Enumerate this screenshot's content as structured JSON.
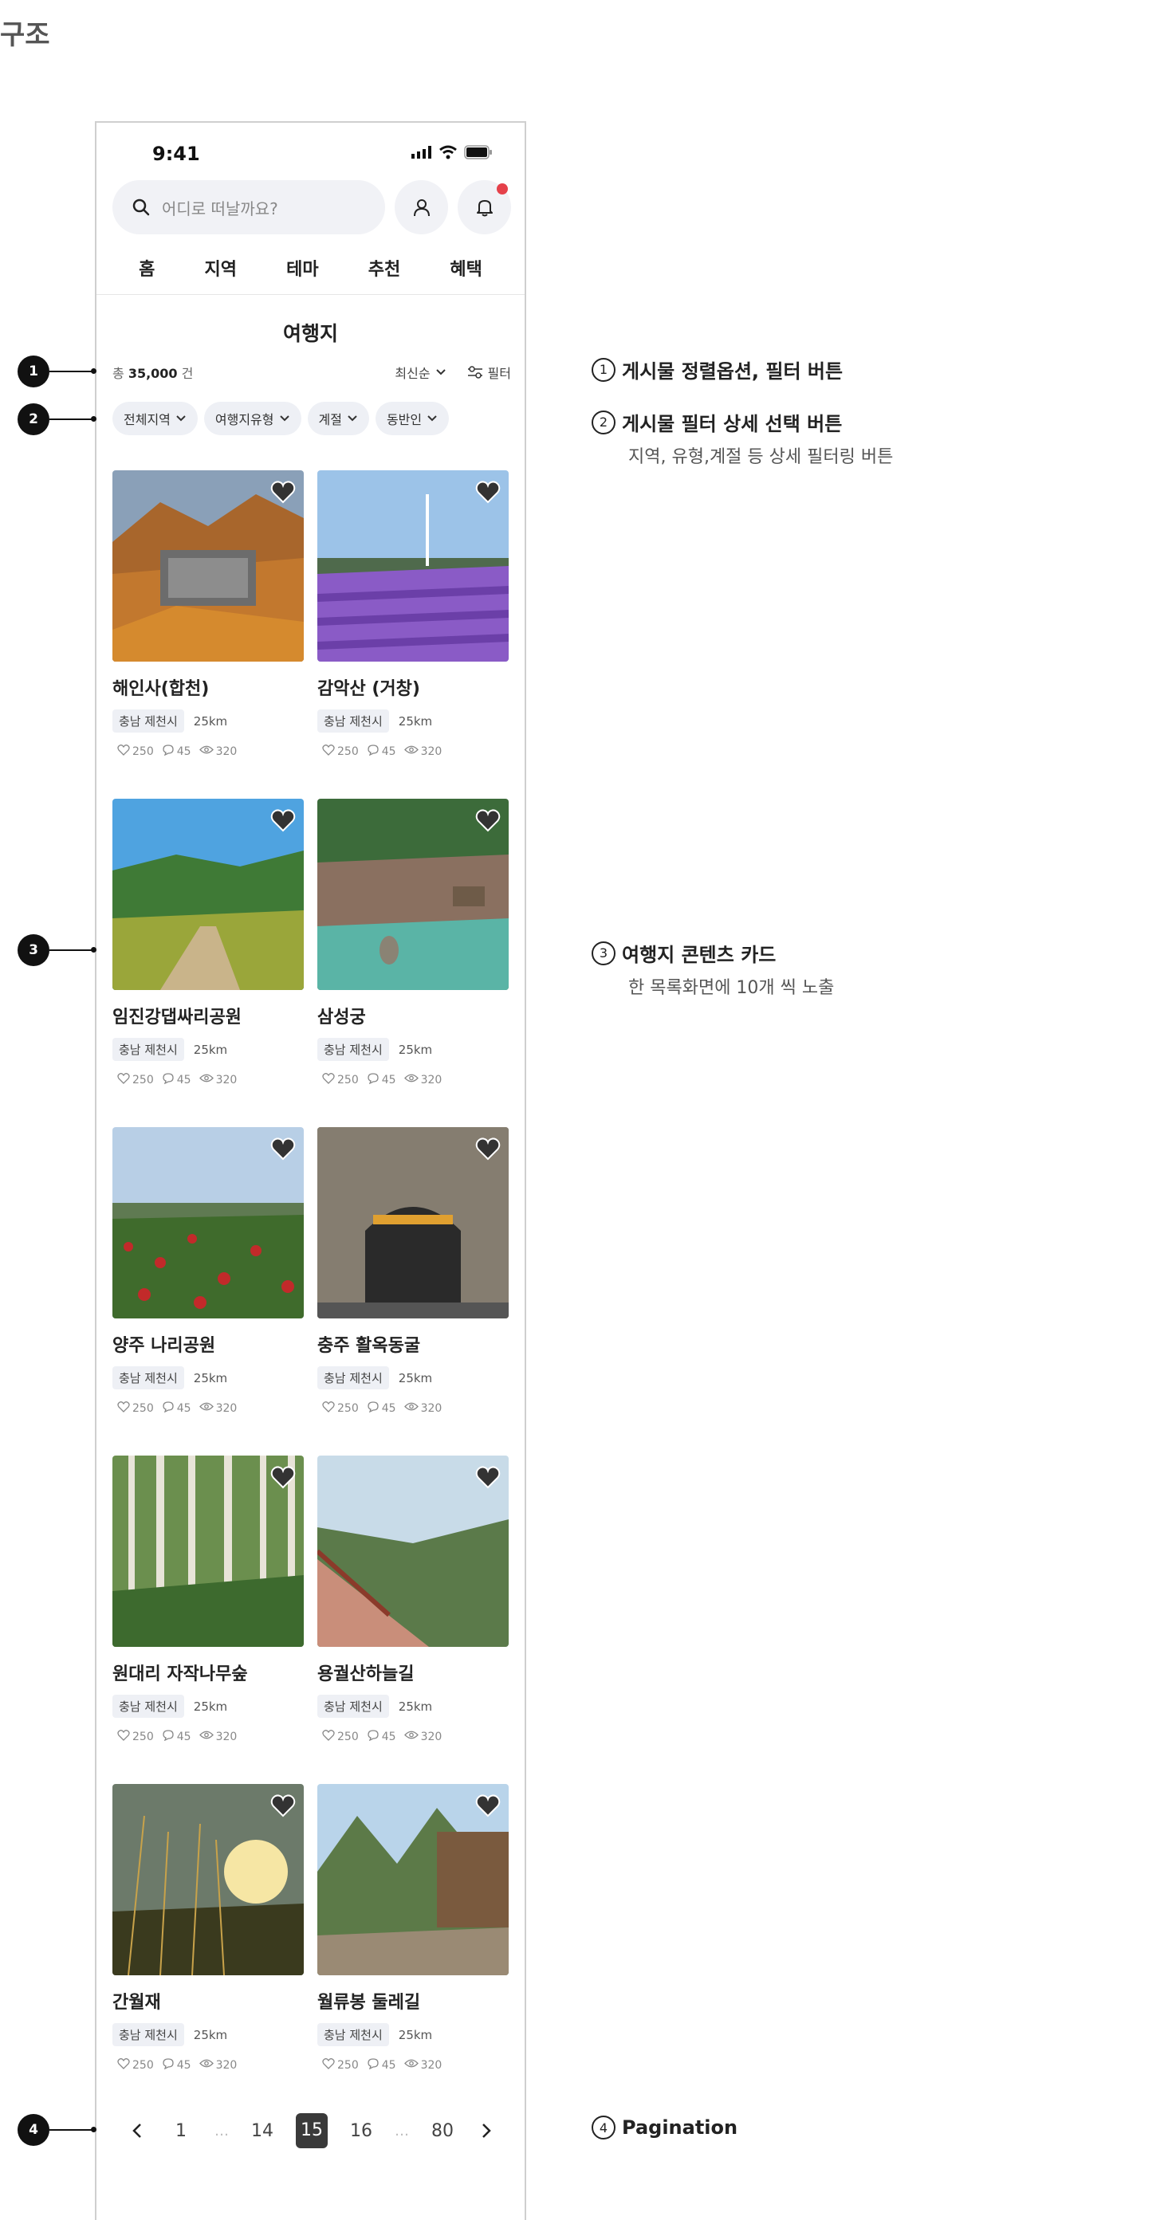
{
  "doc": {
    "title": "구조"
  },
  "status": {
    "time": "9:41"
  },
  "search": {
    "placeholder": "어디로 떠날까요?"
  },
  "nav": {
    "tabs": [
      "홈",
      "지역",
      "테마",
      "추천",
      "혜택"
    ]
  },
  "page": {
    "title": "여행지"
  },
  "list": {
    "count_prefix": "총 ",
    "count_value": "35,000",
    "count_suffix": " 건",
    "sort_label": "최신순",
    "filter_label": "필터"
  },
  "chips": [
    "전체지역",
    "여행지유형",
    "계절",
    "동반인"
  ],
  "cards": [
    {
      "title": "해인사(합천)",
      "region": "충남 제천시",
      "distance": "25km",
      "likes": "250",
      "comments": "45",
      "views": "320",
      "img": "temple"
    },
    {
      "title": "감악산 (거창)",
      "region": "충남 제천시",
      "distance": "25km",
      "likes": "250",
      "comments": "45",
      "views": "320",
      "img": "lavender"
    },
    {
      "title": "임진강댑싸리공원",
      "region": "충남 제천시",
      "distance": "25km",
      "likes": "250",
      "comments": "45",
      "views": "320",
      "img": "field"
    },
    {
      "title": "삼성궁",
      "region": "충남 제천시",
      "distance": "25km",
      "likes": "250",
      "comments": "45",
      "views": "320",
      "img": "pond"
    },
    {
      "title": "양주 나리공원",
      "region": "충남 제천시",
      "distance": "25km",
      "likes": "250",
      "comments": "45",
      "views": "320",
      "img": "flowers"
    },
    {
      "title": "충주 활옥동굴",
      "region": "충남 제천시",
      "distance": "25km",
      "likes": "250",
      "comments": "45",
      "views": "320",
      "img": "cave"
    },
    {
      "title": "원대리 자작나무숲",
      "region": "충남 제천시",
      "distance": "25km",
      "likes": "250",
      "comments": "45",
      "views": "320",
      "img": "birch"
    },
    {
      "title": "용궐산하늘길",
      "region": "충남 제천시",
      "distance": "25km",
      "likes": "250",
      "comments": "45",
      "views": "320",
      "img": "cliff"
    },
    {
      "title": "간월재",
      "region": "충남 제천시",
      "distance": "25km",
      "likes": "250",
      "comments": "45",
      "views": "320",
      "img": "sunset"
    },
    {
      "title": "월류봉 둘레길",
      "region": "충남 제천시",
      "distance": "25km",
      "likes": "250",
      "comments": "45",
      "views": "320",
      "img": "mountain"
    }
  ],
  "pagination": {
    "items": [
      "1",
      "…",
      "14",
      "15",
      "16",
      "…",
      "80"
    ],
    "active": "15"
  },
  "callouts": [
    {
      "num": "1",
      "label": "1",
      "title": "게시물 정렬옵션, 필터 버튼",
      "desc": ""
    },
    {
      "num": "2",
      "label": "2",
      "title": "게시물 필터 상세 선택 버튼",
      "desc": "지역, 유형,계절 등 상세 필터링 버튼"
    },
    {
      "num": "3",
      "label": "3",
      "title": "여행지 콘텐츠 카드",
      "desc": "한 목록화면에 10개 씩 노출"
    },
    {
      "num": "4",
      "label": "4",
      "title": "Pagination",
      "desc": ""
    }
  ],
  "colors": {
    "accent": "#e5414a",
    "chip_bg": "#eef0f5",
    "active_page": "#3a3a3a"
  }
}
